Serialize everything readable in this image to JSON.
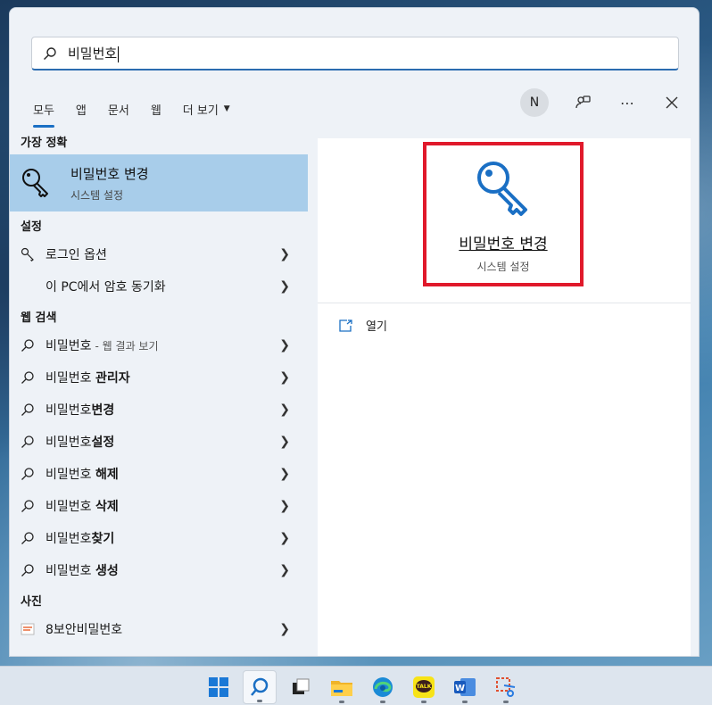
{
  "search": {
    "query": "비밀번호"
  },
  "tabs": [
    {
      "label": "모두",
      "active": true
    },
    {
      "label": "앱"
    },
    {
      "label": "문서"
    },
    {
      "label": "웹"
    },
    {
      "label": "더 보기"
    }
  ],
  "account": {
    "initial": "N"
  },
  "sections": {
    "best_match": "가장 정확",
    "settings": "설정",
    "web_search": "웹 검색",
    "photos": "사진"
  },
  "best_match": {
    "title": "비밀번호 변경",
    "subtitle": "시스템 설정"
  },
  "settings_items": [
    {
      "label": "로그인 옵션",
      "icon": "key-icon"
    },
    {
      "label": "이 PC에서 암호 동기화"
    }
  ],
  "web_items": [
    {
      "label": "비밀번호",
      "suffix": "- 웹 결과 보기",
      "icon": "search-icon"
    },
    {
      "prefix": "비밀번호",
      "bold": "관리자",
      "icon": "search-icon"
    },
    {
      "prefix": "비밀번호",
      "bold": "변경",
      "icon": "search-icon"
    },
    {
      "prefix": "비밀번호",
      "bold": "설정",
      "icon": "search-icon"
    },
    {
      "prefix": "비밀번호",
      "bold": "해제",
      "icon": "search-icon"
    },
    {
      "prefix": "비밀번호",
      "bold": "삭제",
      "icon": "search-icon"
    },
    {
      "prefix": "비밀번호",
      "bold": "찾기",
      "icon": "search-icon"
    },
    {
      "prefix": "비밀번호",
      "bold": "생성",
      "icon": "search-icon"
    }
  ],
  "photo_items": [
    {
      "label": "8보안비밀번호",
      "icon": "image-icon"
    }
  ],
  "detail": {
    "title": "비밀번호 변경",
    "subtitle": "시스템 설정",
    "open_label": "열기"
  },
  "taskbar": {
    "apps": [
      "windows-start",
      "search",
      "task-view",
      "file-explorer",
      "edge",
      "kakaotalk",
      "word",
      "snipping-tool"
    ],
    "kakaotalk_label": "TALK"
  },
  "colors": {
    "accent": "#1a6fc4",
    "selection": "#a8cdea",
    "highlight_border": "#e0192b"
  }
}
